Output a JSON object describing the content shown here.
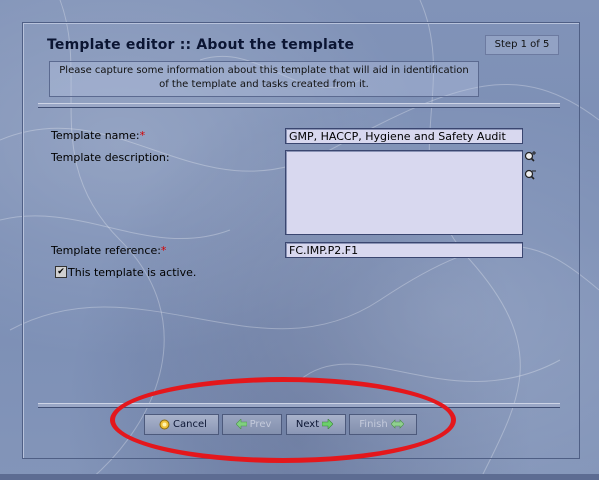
{
  "header": {
    "title": "Template editor :: About the template",
    "step": "Step 1 of 5",
    "info_line1": "Please capture some information about this template that will aid in identification",
    "info_line2": "of the template and tasks created from it."
  },
  "form": {
    "name_label": "Template name:",
    "name_value": "GMP, HACCP, Hygiene and Safety Audit",
    "description_label": "Template description:",
    "description_value": "",
    "reference_label": "Template reference:",
    "reference_value": "FC.IMP.P2.F1",
    "required_mark": "*",
    "active_label": "This template is active.",
    "active_checked": true
  },
  "buttons": {
    "cancel": "Cancel",
    "prev": "Prev",
    "next": "Next",
    "finish": "Finish"
  },
  "colors": {
    "required": "#d40000",
    "highlight_oval": "#e4171c",
    "field_bg": "#d8d8ef"
  },
  "icons": [
    "zoom-in-icon",
    "zoom-out-icon",
    "cancel-icon",
    "arrow-left-icon",
    "arrow-right-icon",
    "finish-icon"
  ]
}
